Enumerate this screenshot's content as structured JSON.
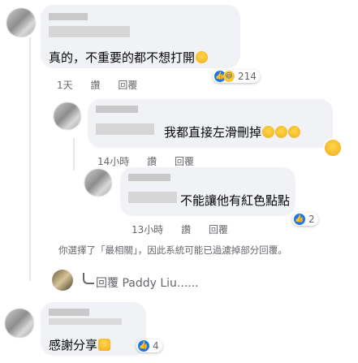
{
  "comments": [
    {
      "text": "真的，不重要的都不想打開",
      "time": "1天",
      "like": "讚",
      "reply": "回覆",
      "reaction_count": "214"
    },
    {
      "text": "我都直接左滑刪掉",
      "time": "14小時",
      "like": "讚",
      "reply": "回覆"
    },
    {
      "text": "不能讓他有紅色點點",
      "time": "13小時",
      "like": "讚",
      "reply": "回覆",
      "reaction_count": "2"
    },
    {
      "text": "感謝分享",
      "reaction_count": "4"
    }
  ],
  "notice": "你選擇了「最相關」，因此系統可能已過濾掉部分回覆。",
  "reply_prompt": "回覆 Paddy Liu......",
  "colors": {
    "bubble": "#f0f2f5",
    "like_blue": "#1877f2",
    "meta_gray": "#65676b"
  }
}
